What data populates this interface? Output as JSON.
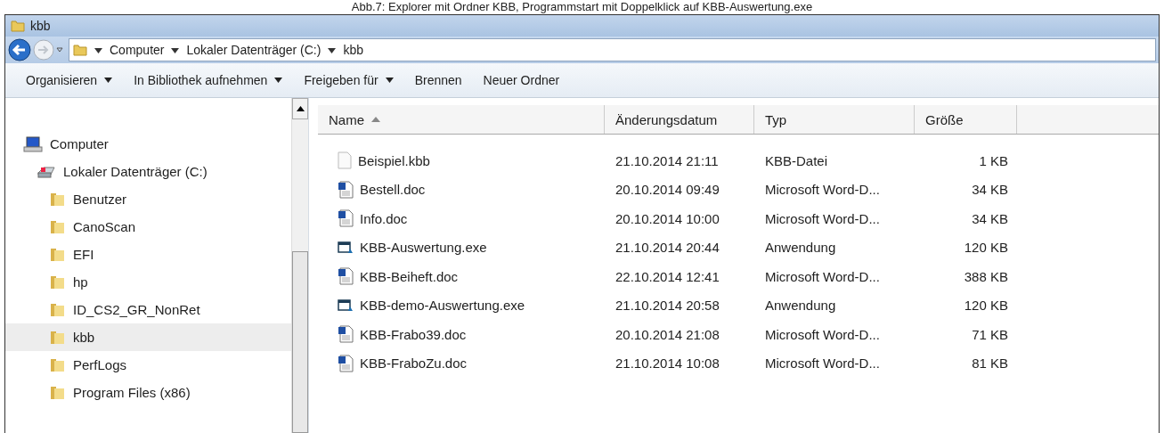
{
  "caption": "Abb.7: Explorer mit Ordner KBB, Programmstart mit Doppelklick auf KBB-Auswertung.exe",
  "window": {
    "title": "kbb"
  },
  "address_bar": {
    "path": [
      "Computer",
      "Lokaler Datenträger (C:)",
      "kbb"
    ]
  },
  "toolbar": [
    {
      "label": "Organisieren",
      "dropdown": true
    },
    {
      "label": "In Bibliothek aufnehmen",
      "dropdown": true
    },
    {
      "label": "Freigeben für",
      "dropdown": true
    },
    {
      "label": "Brennen",
      "dropdown": false
    },
    {
      "label": "Neuer Ordner",
      "dropdown": false
    }
  ],
  "sidebar": {
    "items": [
      {
        "label": "Computer",
        "kind": "computer",
        "selected": false,
        "children": [
          {
            "label": "Lokaler Datenträger (C:)",
            "kind": "drive",
            "selected": false,
            "children": [
              {
                "label": "Benutzer",
                "kind": "folder",
                "selected": false
              },
              {
                "label": "CanoScan",
                "kind": "folder",
                "selected": false
              },
              {
                "label": "EFI",
                "kind": "folder",
                "selected": false
              },
              {
                "label": "hp",
                "kind": "folder",
                "selected": false
              },
              {
                "label": "ID_CS2_GR_NonRet",
                "kind": "folder",
                "selected": false
              },
              {
                "label": "kbb",
                "kind": "folder",
                "selected": true
              },
              {
                "label": "PerfLogs",
                "kind": "folder",
                "selected": false
              },
              {
                "label": "Program Files (x86)",
                "kind": "folder",
                "selected": false
              }
            ]
          }
        ]
      }
    ]
  },
  "table": {
    "columns": [
      {
        "label": "Name",
        "sorted": true
      },
      {
        "label": "Änderungsdatum",
        "sorted": false
      },
      {
        "label": "Typ",
        "sorted": false
      },
      {
        "label": "Größe",
        "sorted": false
      }
    ],
    "rows": [
      {
        "kind": "file",
        "name": "Beispiel.kbb",
        "date": "21.10.2014 21:11",
        "type": "KBB-Datei",
        "size": "1 KB"
      },
      {
        "kind": "word",
        "name": "Bestell.doc",
        "date": "20.10.2014 09:49",
        "type": "Microsoft Word-D...",
        "size": "34 KB"
      },
      {
        "kind": "word",
        "name": "Info.doc",
        "date": "20.10.2014 10:00",
        "type": "Microsoft Word-D...",
        "size": "34 KB"
      },
      {
        "kind": "program",
        "name": "KBB-Auswertung.exe",
        "date": "21.10.2014 20:44",
        "type": "Anwendung",
        "size": "120 KB"
      },
      {
        "kind": "word",
        "name": "KBB-Beiheft.doc",
        "date": "22.10.2014 12:41",
        "type": "Microsoft Word-D...",
        "size": "388 KB"
      },
      {
        "kind": "program",
        "name": "KBB-demo-Auswertung.exe",
        "date": "21.10.2014 20:58",
        "type": "Anwendung",
        "size": "120 KB"
      },
      {
        "kind": "word",
        "name": "KBB-Frabo39.doc",
        "date": "20.10.2014 21:08",
        "type": "Microsoft Word-D...",
        "size": "71 KB"
      },
      {
        "kind": "word",
        "name": "KBB-FraboZu.doc",
        "date": "21.10.2014 10:08",
        "type": "Microsoft Word-D...",
        "size": "81 KB"
      }
    ]
  }
}
